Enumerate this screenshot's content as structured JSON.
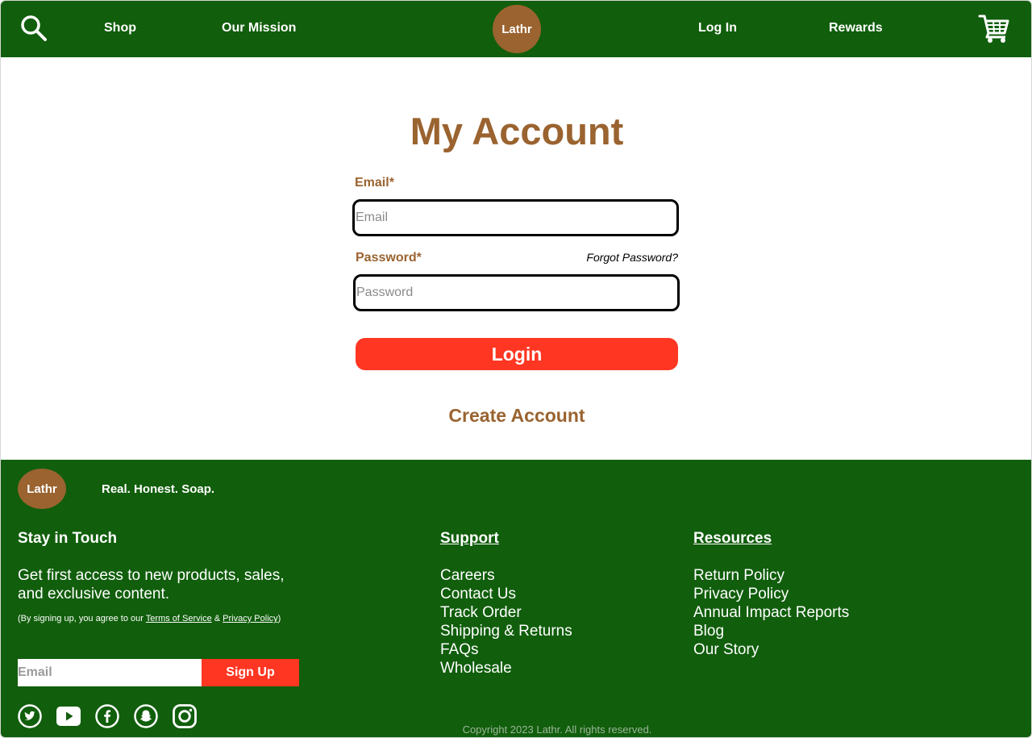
{
  "header": {
    "nav": {
      "shop": "Shop",
      "mission": "Our Mission",
      "login": "Log In",
      "rewards": "Rewards"
    },
    "logo_text": "Lathr",
    "icons": {
      "search": "search-icon",
      "cart": "cart-icon"
    }
  },
  "main": {
    "title": "My Account",
    "email_label": "Email*",
    "email_placeholder": "Email",
    "password_label": "Password*",
    "password_placeholder": "Password",
    "forgot_password": "Forgot Password?",
    "login_button": "Login",
    "create_account": "Create Account"
  },
  "footer": {
    "logo_text": "Lathr",
    "tagline": "Real. Honest. Soap.",
    "stay_in_touch": {
      "heading": "Stay in Touch",
      "promo": "Get first access to new products, sales, and exclusive content.",
      "legal_prefix": "(By signing up, you agree to our ",
      "terms": "Terms of Service",
      "amp": " & ",
      "privacy": "Privacy Policy",
      "legal_suffix": ")",
      "email_placeholder": "Email",
      "signup_button": "Sign Up"
    },
    "support": {
      "heading": "Support",
      "links": [
        "Careers",
        "Contact Us",
        "Track Order",
        "Shipping & Returns",
        "FAQs",
        "Wholesale"
      ]
    },
    "resources": {
      "heading": "Resources",
      "links": [
        "Return Policy",
        "Privacy Policy",
        "Annual Impact Reports",
        "Blog",
        "Our Story"
      ]
    },
    "social_icons": [
      "twitter-icon",
      "youtube-icon",
      "facebook-icon",
      "snapchat-icon",
      "instagram-icon"
    ],
    "copyright": "Copyright 2023 Lathr. All rights reserved."
  },
  "colors": {
    "brand_green": "#115e0c",
    "brand_brown": "#9a6330",
    "accent_red": "#ff3622"
  }
}
